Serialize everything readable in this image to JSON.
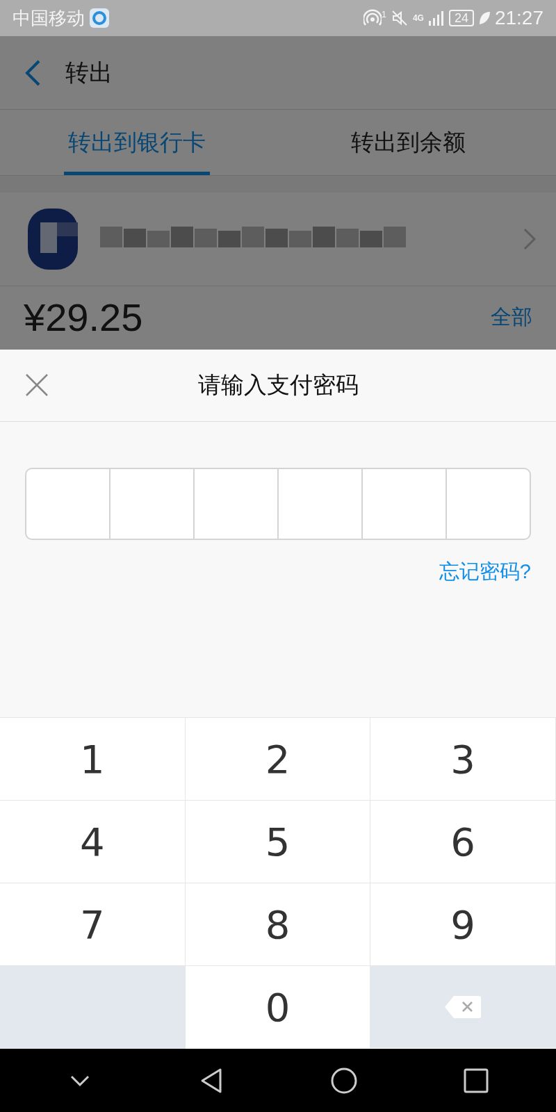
{
  "status_bar": {
    "carrier": "中国移动",
    "hotspot_count": "1",
    "network": "4G",
    "battery": "24",
    "time": "21:27"
  },
  "header": {
    "title": "转出"
  },
  "tabs": [
    {
      "label": "转出到银行卡",
      "selected": true
    },
    {
      "label": "转出到余额",
      "selected": false
    }
  ],
  "amount": {
    "value": "¥29.25",
    "all_link": "全部"
  },
  "password_sheet": {
    "title": "请输入支付密码",
    "boxes": [
      {
        "filled": false
      },
      {
        "filled": false
      },
      {
        "filled": false
      },
      {
        "filled": false
      },
      {
        "filled": false
      },
      {
        "filled": false
      }
    ],
    "forgot_link": "忘记密码?"
  },
  "keypad": [
    {
      "kind": "digit",
      "label": "1"
    },
    {
      "kind": "digit",
      "label": "2"
    },
    {
      "kind": "digit",
      "label": "3"
    },
    {
      "kind": "digit",
      "label": "4"
    },
    {
      "kind": "digit",
      "label": "5"
    },
    {
      "kind": "digit",
      "label": "6"
    },
    {
      "kind": "digit",
      "label": "7"
    },
    {
      "kind": "digit",
      "label": "8"
    },
    {
      "kind": "digit",
      "label": "9"
    },
    {
      "kind": "blank"
    },
    {
      "kind": "digit",
      "label": "0"
    },
    {
      "kind": "backspace"
    }
  ]
}
